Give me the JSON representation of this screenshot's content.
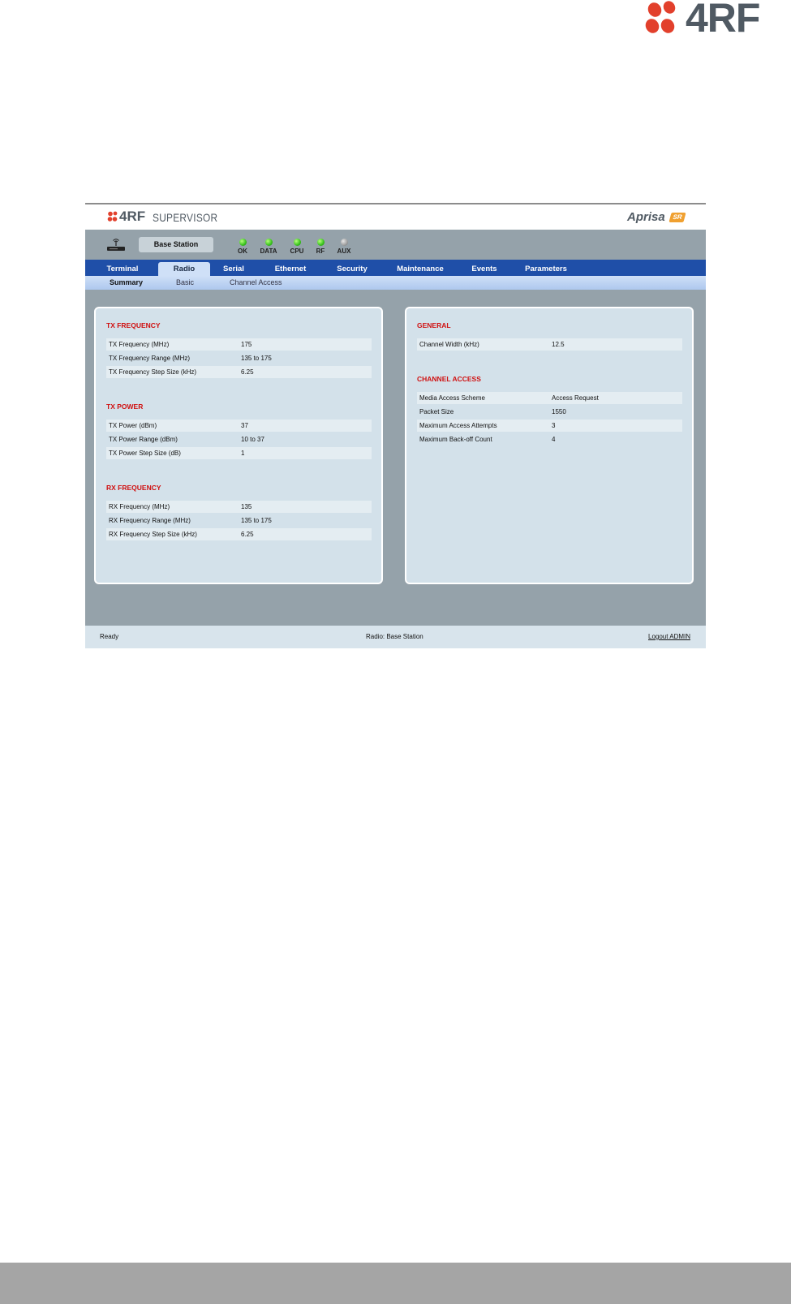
{
  "company_logo": {
    "text": "4RF"
  },
  "app": {
    "brand_4rf": "4RF",
    "brand_supervisor": "SUPERVISOR",
    "product": "Aprisa",
    "product_badge": "SR"
  },
  "status": {
    "station_name": "Base Station",
    "leds": [
      {
        "label": "OK",
        "state": "green"
      },
      {
        "label": "DATA",
        "state": "green"
      },
      {
        "label": "CPU",
        "state": "green"
      },
      {
        "label": "RF",
        "state": "green"
      },
      {
        "label": "AUX",
        "state": "grey"
      }
    ]
  },
  "nav": {
    "tabs": [
      {
        "label": "Terminal"
      },
      {
        "label": "Radio",
        "active": true
      },
      {
        "label": "Serial"
      },
      {
        "label": "Ethernet"
      },
      {
        "label": "Security"
      },
      {
        "label": "Maintenance"
      },
      {
        "label": "Events"
      },
      {
        "label": "Parameters"
      }
    ]
  },
  "subnav": {
    "tabs": [
      {
        "label": "Summary",
        "active": true
      },
      {
        "label": "Basic"
      },
      {
        "label": "Channel Access"
      }
    ]
  },
  "left_panel": {
    "sections": [
      {
        "title": "TX FREQUENCY",
        "rows": [
          {
            "label": "TX Frequency (MHz)",
            "value": "175"
          },
          {
            "label": "TX Frequency Range (MHz)",
            "value": "135 to 175"
          },
          {
            "label": "TX Frequency Step Size (kHz)",
            "value": "6.25"
          }
        ]
      },
      {
        "title": "TX POWER",
        "rows": [
          {
            "label": "TX Power (dBm)",
            "value": "37"
          },
          {
            "label": "TX Power Range (dBm)",
            "value": "10 to 37"
          },
          {
            "label": "TX Power Step Size (dB)",
            "value": "1"
          }
        ]
      },
      {
        "title": "RX FREQUENCY",
        "rows": [
          {
            "label": "RX Frequency (MHz)",
            "value": "135"
          },
          {
            "label": "RX Frequency Range (MHz)",
            "value": "135 to 175"
          },
          {
            "label": "RX Frequency Step Size (kHz)",
            "value": "6.25"
          }
        ]
      }
    ]
  },
  "right_panel": {
    "sections": [
      {
        "title": "GENERAL",
        "rows": [
          {
            "label": "Channel Width (kHz)",
            "value": "12.5"
          }
        ]
      },
      {
        "title": "CHANNEL ACCESS",
        "rows": [
          {
            "label": "Media Access Scheme",
            "value": "Access Request"
          },
          {
            "label": "Packet Size",
            "value": "1550"
          },
          {
            "label": "Maximum Access Attempts",
            "value": "3"
          },
          {
            "label": "Maximum Back-off Count",
            "value": "4"
          }
        ]
      }
    ]
  },
  "footer": {
    "status": "Ready",
    "center": "Radio: Base Station",
    "logout": "Logout ADMIN"
  },
  "colors": {
    "nav_blue": "#1f4fa8",
    "section_title_red": "#d01010",
    "led_green": "#37c21c",
    "logo_red": "#e2402c"
  }
}
